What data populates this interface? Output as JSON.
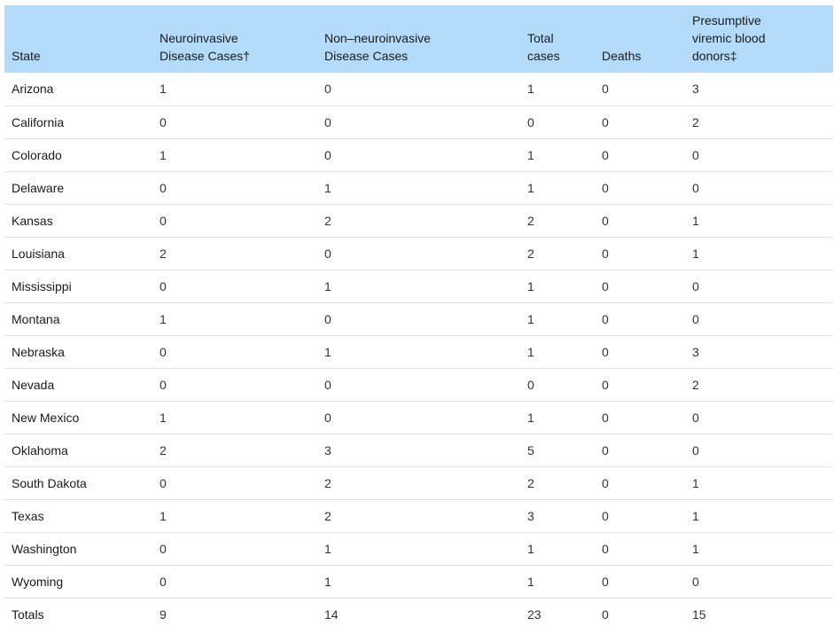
{
  "table": {
    "headers": [
      "State",
      "Neuroinvasive Disease Cases†",
      "Non–neuroinvasive Disease Cases",
      "Total cases",
      "Deaths",
      "Presumptive viremic blood donors‡"
    ],
    "rows": [
      [
        "Arizona",
        "1",
        "0",
        "1",
        "0",
        "3"
      ],
      [
        "California",
        "0",
        "0",
        "0",
        "0",
        "2"
      ],
      [
        "Colorado",
        "1",
        "0",
        "1",
        "0",
        "0"
      ],
      [
        "Delaware",
        "0",
        "1",
        "1",
        "0",
        "0"
      ],
      [
        "Kansas",
        "0",
        "2",
        "2",
        "0",
        "1"
      ],
      [
        "Louisiana",
        "2",
        "0",
        "2",
        "0",
        "1"
      ],
      [
        "Mississippi",
        "0",
        "1",
        "1",
        "0",
        "0"
      ],
      [
        "Montana",
        "1",
        "0",
        "1",
        "0",
        "0"
      ],
      [
        "Nebraska",
        "0",
        "1",
        "1",
        "0",
        "3"
      ],
      [
        "Nevada",
        "0",
        "0",
        "0",
        "0",
        "2"
      ],
      [
        "New Mexico",
        "1",
        "0",
        "1",
        "0",
        "0"
      ],
      [
        "Oklahoma",
        "2",
        "3",
        "5",
        "0",
        "0"
      ],
      [
        "South Dakota",
        "0",
        "2",
        "2",
        "0",
        "1"
      ],
      [
        "Texas",
        "1",
        "2",
        "3",
        "0",
        "1"
      ],
      [
        "Washington",
        "0",
        "1",
        "1",
        "0",
        "1"
      ],
      [
        "Wyoming",
        "0",
        "1",
        "1",
        "0",
        "0"
      ]
    ],
    "totals": [
      "Totals",
      "9",
      "14",
      "23",
      "0",
      "15"
    ]
  },
  "colors": {
    "header_bg": "#b5dbfb",
    "row_divider": "#e2e2e2"
  }
}
